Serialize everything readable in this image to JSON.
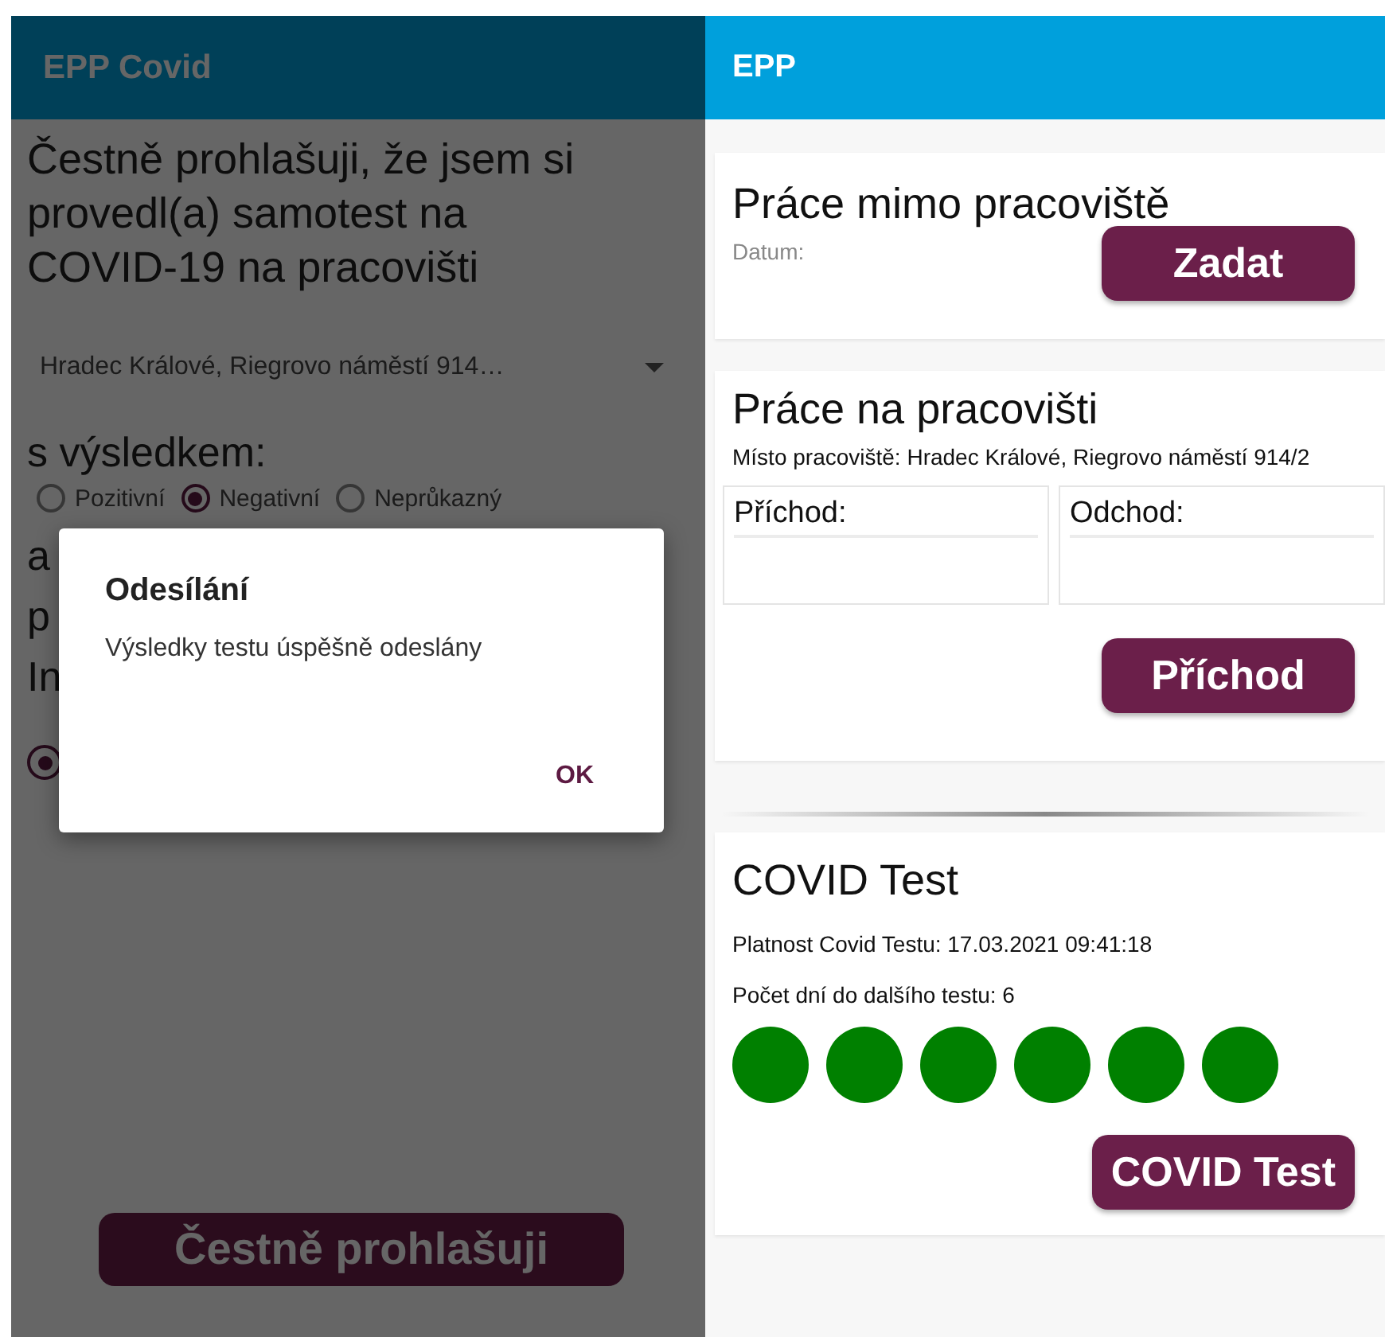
{
  "left_screen": {
    "app_bar": {
      "title": "EPP Covid"
    },
    "declaration": "Čestně prohlašuji, že jsem si provedl(a) samotest na COVID-19 na pracovišti",
    "workplace_dropdown": {
      "value": "Hradec Králové, Riegrovo náměstí 914…"
    },
    "result_label": "s výsledkem:",
    "result_options": [
      {
        "label": "Pozitivní",
        "selected": false
      },
      {
        "label": "Negativní",
        "selected": true
      },
      {
        "label": "Neprůkazný",
        "selected": false
      }
    ],
    "partial_texts": [
      "a",
      "p",
      "In"
    ],
    "partial_radio": {
      "selected": true
    },
    "submit_button": "Čestně prohlašuji",
    "dialog": {
      "title": "Odesílání",
      "message": "Výsledky testu úspěšně odeslány",
      "ok_button": "OK"
    }
  },
  "right_screen": {
    "app_bar": {
      "title": "EPP"
    },
    "remote_work": {
      "title": "Práce mimo pracoviště",
      "date_label": "Datum:",
      "button": "Zadat"
    },
    "onsite_work": {
      "title": "Práce na pracovišti",
      "place": "Místo pracoviště: Hradec Králové, Riegrovo náměstí 914/2",
      "arrival_label": "Příchod:",
      "departure_label": "Odchod:",
      "button": "Příchod"
    },
    "covid_test": {
      "title": "COVID Test",
      "validity": "Platnost Covid Testu: 17.03.2021 09:41:18",
      "days_left": "Počet dní do dalšího testu: 6",
      "stars": 6,
      "button": "COVID Test"
    }
  }
}
